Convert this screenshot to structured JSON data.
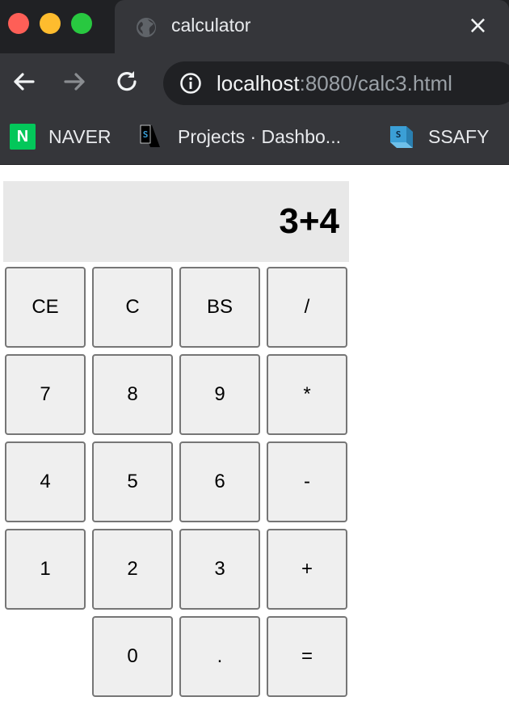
{
  "browser": {
    "tab": {
      "title": "calculator",
      "favicon": "globe-icon",
      "close": "×"
    },
    "nav": {
      "back": "arrow-left-icon",
      "forward": "arrow-right-icon",
      "reload": "reload-icon"
    },
    "address": {
      "host": "localhost",
      "rest": ":8080/calc3.html",
      "info_icon": "info-icon"
    },
    "bookmarks": [
      {
        "label": "NAVER",
        "icon": "naver-icon",
        "icon_text": "N"
      },
      {
        "label": "Projects · Dashbo...",
        "icon": "ssafy-s-icon"
      },
      {
        "label": "SSAFY",
        "icon": "ssafy-folder-icon"
      }
    ],
    "colors": {
      "close_red": "#fe5f57",
      "minimize_yellow": "#febc2e",
      "zoom_green": "#28c840",
      "naver_green": "#03c75a",
      "ssafy_blue": "#3b9fd6"
    }
  },
  "calculator": {
    "display": "3+4",
    "keys": [
      [
        "CE",
        "C",
        "BS",
        "/"
      ],
      [
        "7",
        "8",
        "9",
        "*"
      ],
      [
        "4",
        "5",
        "6",
        "-"
      ],
      [
        "1",
        "2",
        "3",
        "+"
      ],
      [
        "",
        "0",
        ".",
        "="
      ]
    ]
  }
}
